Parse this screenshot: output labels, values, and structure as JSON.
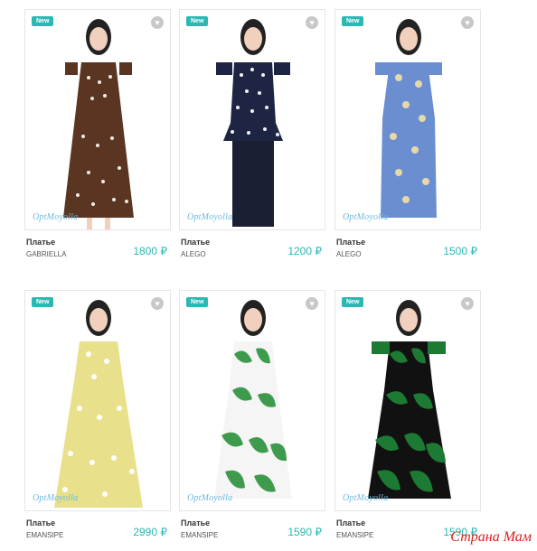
{
  "products": [
    {
      "badge": "New",
      "brand": "OptMoyolla",
      "type": "Платье",
      "model": "GABRIELLA",
      "price": "1800 ₽",
      "colors": {
        "dress": "#5a3521",
        "pattern": "#f1ece5",
        "skirt": "#5a3521"
      }
    },
    {
      "badge": "New",
      "brand": "OptMoyolla",
      "type": "Платье",
      "model": "ALEGO",
      "price": "1200 ₽",
      "colors": {
        "dress": "#1e2543",
        "pattern": "#f3f3f3",
        "skirt": "#1a1f33"
      }
    },
    {
      "badge": "New",
      "brand": "OptMoyolla",
      "type": "Платье",
      "model": "ALEGO",
      "price": "1500 ₽",
      "colors": {
        "dress": "#6b8ed1",
        "pattern": "#e8d8a8",
        "skirt": "#6b8ed1"
      }
    },
    {
      "badge": "New",
      "brand": "OptMoyolla",
      "type": "Платье",
      "model": "EMANSIPE",
      "price": "2990 ₽",
      "colors": {
        "dress": "#e8e08a",
        "pattern": "#ffffff",
        "skirt": "#e8e08a"
      }
    },
    {
      "badge": "New",
      "brand": "OptMoyolla",
      "type": "Платье",
      "model": "EMANSIPE",
      "price": "1590 ₽",
      "colors": {
        "dress": "#3e9a4d",
        "pattern": "#f5f5f5",
        "skirt": "#3e9a4d"
      }
    },
    {
      "badge": "New",
      "brand": "OptMoyolla",
      "type": "Платье",
      "model": "EMANSIPE",
      "price": "1590 ₽",
      "colors": {
        "dress": "#1c7a33",
        "pattern": "#111111",
        "skirt": "#2a7c3a"
      }
    }
  ],
  "watermark": "Страна Мам"
}
